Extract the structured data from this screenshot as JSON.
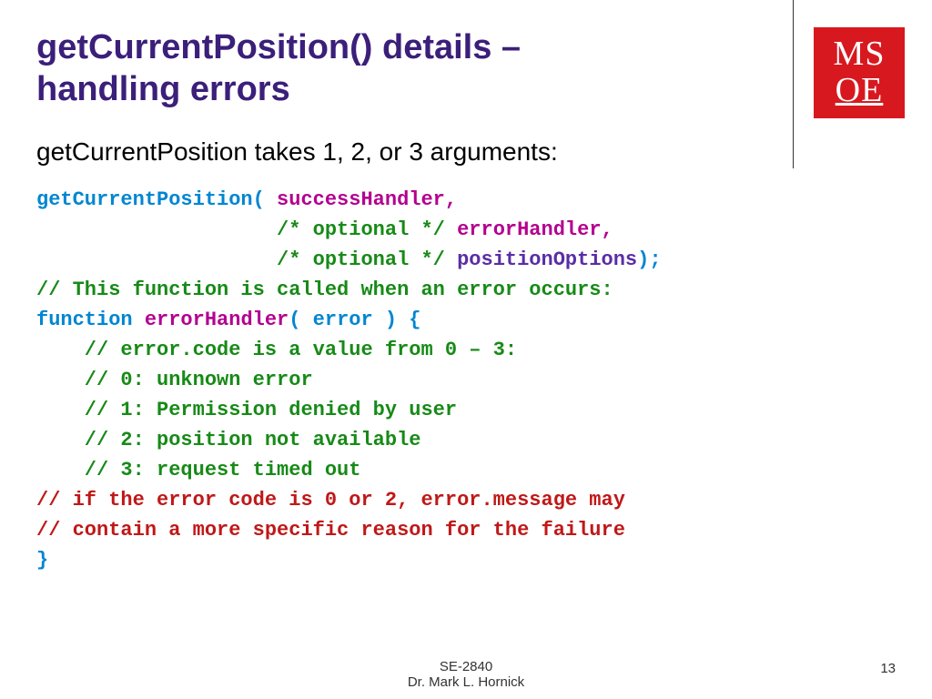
{
  "header": {
    "title": "getCurrentPosition() details – handling errors",
    "logo_top": "MS",
    "logo_bottom": "OE"
  },
  "intro": "getCurrentPosition takes 1, 2, or 3 arguments:",
  "code": {
    "fn_name": "getCurrentPosition",
    "open_paren": "( ",
    "arg1": "successHandler",
    "comma1": ",",
    "pad2": "                    ",
    "opt1": "/* optional */ ",
    "arg2": "errorHandler",
    "comma2": ",",
    "pad3": "                    ",
    "opt2": "/* optional */ ",
    "arg3": "positionOptions",
    "close": ");",
    "c1": "// This function is called when an error occurs:",
    "kw_function": "function ",
    "err_name": "errorHandler",
    "err_sig": "( error ) {",
    "b1": "    // error.code is a value from 0 – 3:",
    "b2": "    // 0: unknown error",
    "b3": "    // 1: Permission denied by user",
    "b4": "    // 2: position not available",
    "b5": "    // 3: request timed out",
    "tail1": "// if the error code is 0 or 2, error.message may",
    "tail2": "// contain a more specific reason for the failure",
    "close_brace": "}"
  },
  "footer": {
    "course": "SE-2840",
    "author": "Dr. Mark L. Hornick",
    "page": "13"
  }
}
